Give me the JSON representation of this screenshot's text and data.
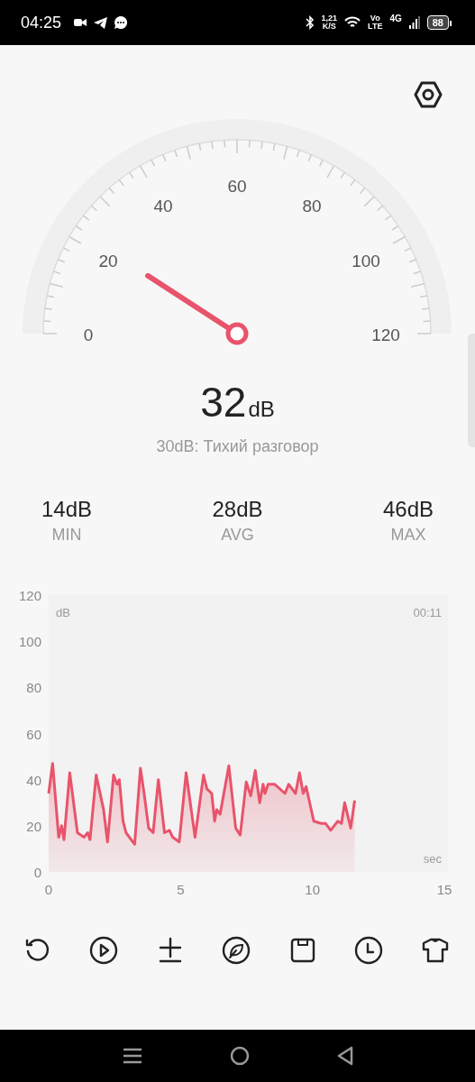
{
  "status_bar": {
    "time": "04:25",
    "speed": "1,21",
    "speed_unit": "K/S",
    "volte_top": "Vo",
    "volte_bottom": "LTE",
    "network": "4G",
    "battery": "88"
  },
  "gauge": {
    "labels": [
      "0",
      "20",
      "40",
      "60",
      "80",
      "100",
      "120"
    ]
  },
  "reading": {
    "value": "32",
    "unit": "dB",
    "description": "30dB: Тихий разговор"
  },
  "stats": [
    {
      "value": "14dB",
      "label": "MIN"
    },
    {
      "value": "28dB",
      "label": "AVG"
    },
    {
      "value": "46dB",
      "label": "MAX"
    }
  ],
  "chart": {
    "y_unit": "dB",
    "elapsed": "00:11",
    "x_unit": "sec",
    "chart_data": {
      "type": "area",
      "xlim": [
        0,
        15
      ],
      "ylim": [
        0,
        120
      ],
      "xticks": [
        0,
        5,
        10,
        15
      ],
      "yticks": [
        0,
        20,
        40,
        60,
        80,
        100,
        120
      ],
      "x": [
        0,
        0.15,
        0.38,
        0.49,
        0.58,
        0.8,
        1.09,
        1.34,
        1.48,
        1.57,
        1.8,
        2.08,
        2.23,
        2.46,
        2.59,
        2.68,
        2.82,
        2.93,
        3.26,
        3.48,
        3.62,
        3.79,
        3.96,
        4.16,
        4.39,
        4.58,
        4.7,
        4.95,
        5.21,
        5.55,
        5.87,
        6.0,
        6.18,
        6.29,
        6.37,
        6.5,
        6.83,
        7.09,
        7.26,
        7.49,
        7.66,
        7.83,
        8.0,
        8.13,
        8.2,
        8.32,
        8.57,
        8.96,
        9.1,
        9.36,
        9.51,
        9.65,
        9.76,
        10.05,
        10.33,
        10.5,
        10.69,
        10.96,
        11.1,
        11.22,
        11.45,
        11.6
      ],
      "series": [
        {
          "color": "#e8546b",
          "values": [
            34,
            47,
            15,
            20,
            14,
            43,
            17,
            15,
            17,
            14,
            42,
            27,
            13,
            42,
            38,
            40,
            22,
            17,
            12,
            45,
            34,
            19,
            17,
            40,
            17,
            18,
            15,
            13,
            43,
            15,
            42,
            36,
            34,
            22,
            27,
            25,
            46,
            19,
            16,
            39,
            33,
            44,
            30,
            38,
            34,
            38,
            38,
            34,
            38,
            34,
            43,
            34,
            37,
            22,
            21,
            21,
            18,
            22,
            21,
            30,
            19,
            31
          ]
        }
      ]
    }
  },
  "toolbar": [
    {
      "kind": "reset"
    },
    {
      "kind": "play"
    },
    {
      "kind": "calibrate"
    },
    {
      "kind": "leaf"
    },
    {
      "kind": "save"
    },
    {
      "kind": "history"
    },
    {
      "kind": "theme"
    }
  ]
}
